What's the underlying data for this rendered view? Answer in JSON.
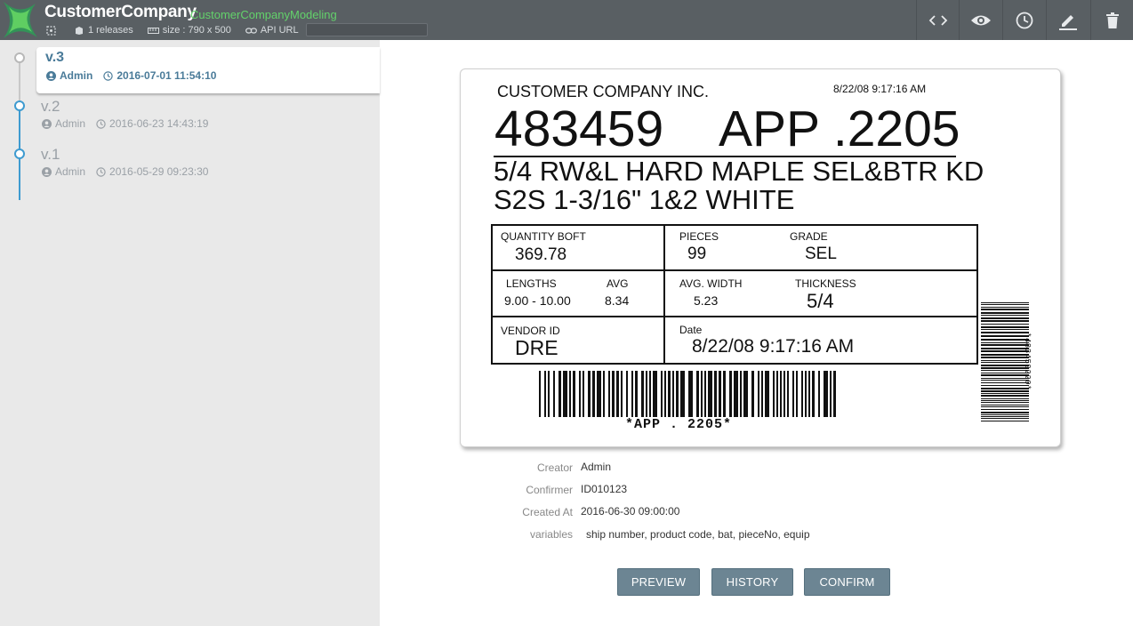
{
  "header": {
    "app_name": "CustomerCompany",
    "app_sub": "CustomerCompanyModeling",
    "releases": "1 releases",
    "size": "size : 790 x 500",
    "api_url": "API URL",
    "api_value": ""
  },
  "toolbar": [
    "code-icon",
    "eye-icon",
    "history-icon",
    "edit-icon",
    "trash-icon"
  ],
  "versions": [
    {
      "name": "v.3",
      "user": "Admin",
      "date": "2016-07-01 11:54:10"
    },
    {
      "name": "v.2",
      "user": "Admin",
      "date": "2016-06-23 14:43:19"
    },
    {
      "name": "v.1",
      "user": "Admin",
      "date": "2016-05-29 09:23:30"
    }
  ],
  "label": {
    "company": "CUSTOMER COMPANY INC.",
    "timestamp": "8/22/08 9:17:16 AM",
    "big_number": "483459",
    "big_code": "APP .2205",
    "desc1": "5/4  RW&L HARD MAPLE SEL&BTR KD",
    "desc2": "S2S  1-3/16\"  1&2 WHITE",
    "quantity_label": "QUANTITY   BOFT",
    "quantity": "369.78",
    "pieces_label": "PIECES",
    "pieces": "99",
    "grade_label": "GRADE",
    "grade": "SEL",
    "lengths_label": "LENGTHS",
    "lengths": "9.00 - 10.00",
    "avg_label": "AVG",
    "avg": "8.34",
    "avg_width_label": "AVG. WIDTH",
    "avg_width": "5.23",
    "thickness_label": "THICKNESS",
    "thickness": "5/4",
    "vendor_label": "VENDOR  ID",
    "vendor": "DRE",
    "date_label": "Date",
    "date": "8/22/08 9:17:16 AM",
    "barcode_text": "*APP . 2205*",
    "side_barcode_text": "*483459220*"
  },
  "info": {
    "creator_label": "Creator",
    "creator": "Admin",
    "confirmer_label": "Confirmer",
    "confirmer": "ID010123",
    "created_label": "Created At",
    "created": "2016-06-30 09:00:00",
    "variables_label": "variables",
    "variables": "ship number, product code, bat, pieceNo, equip"
  },
  "buttons": {
    "preview": "PREVIEW",
    "history": "HISTORY",
    "confirm": "CONFIRM"
  },
  "colors": {
    "header": "#595f63",
    "accent_green": "#63d26b",
    "timeline": "#3e9bd0",
    "button": "#6c8593"
  }
}
